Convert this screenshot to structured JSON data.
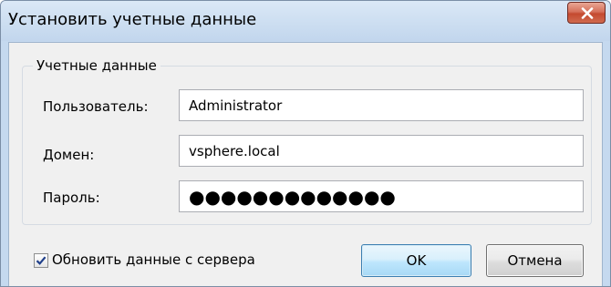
{
  "window": {
    "title": "Установить учетные данные"
  },
  "credentials": {
    "group_title": "Учетные данные",
    "user_label": "Пользователь:",
    "user_value": "Administrator",
    "domain_label": "Домен:",
    "domain_value": "vsphere.local",
    "password_label": "Пароль:",
    "password_value": "●●●●●●●●●●●●●"
  },
  "options": {
    "refresh_label": "Обновить данные с сервера",
    "refresh_checked": true
  },
  "buttons": {
    "ok_label": "OK",
    "cancel_label": "Отмена"
  },
  "colors": {
    "title_bar": "#cfe0f2",
    "close_button": "#c44a30",
    "client_background": "#f0f0f0",
    "ok_button_border": "#3c7fb1",
    "checkmark": "#1f3f8a"
  },
  "icons": {
    "close": "close-icon",
    "check": "checkmark-icon"
  }
}
